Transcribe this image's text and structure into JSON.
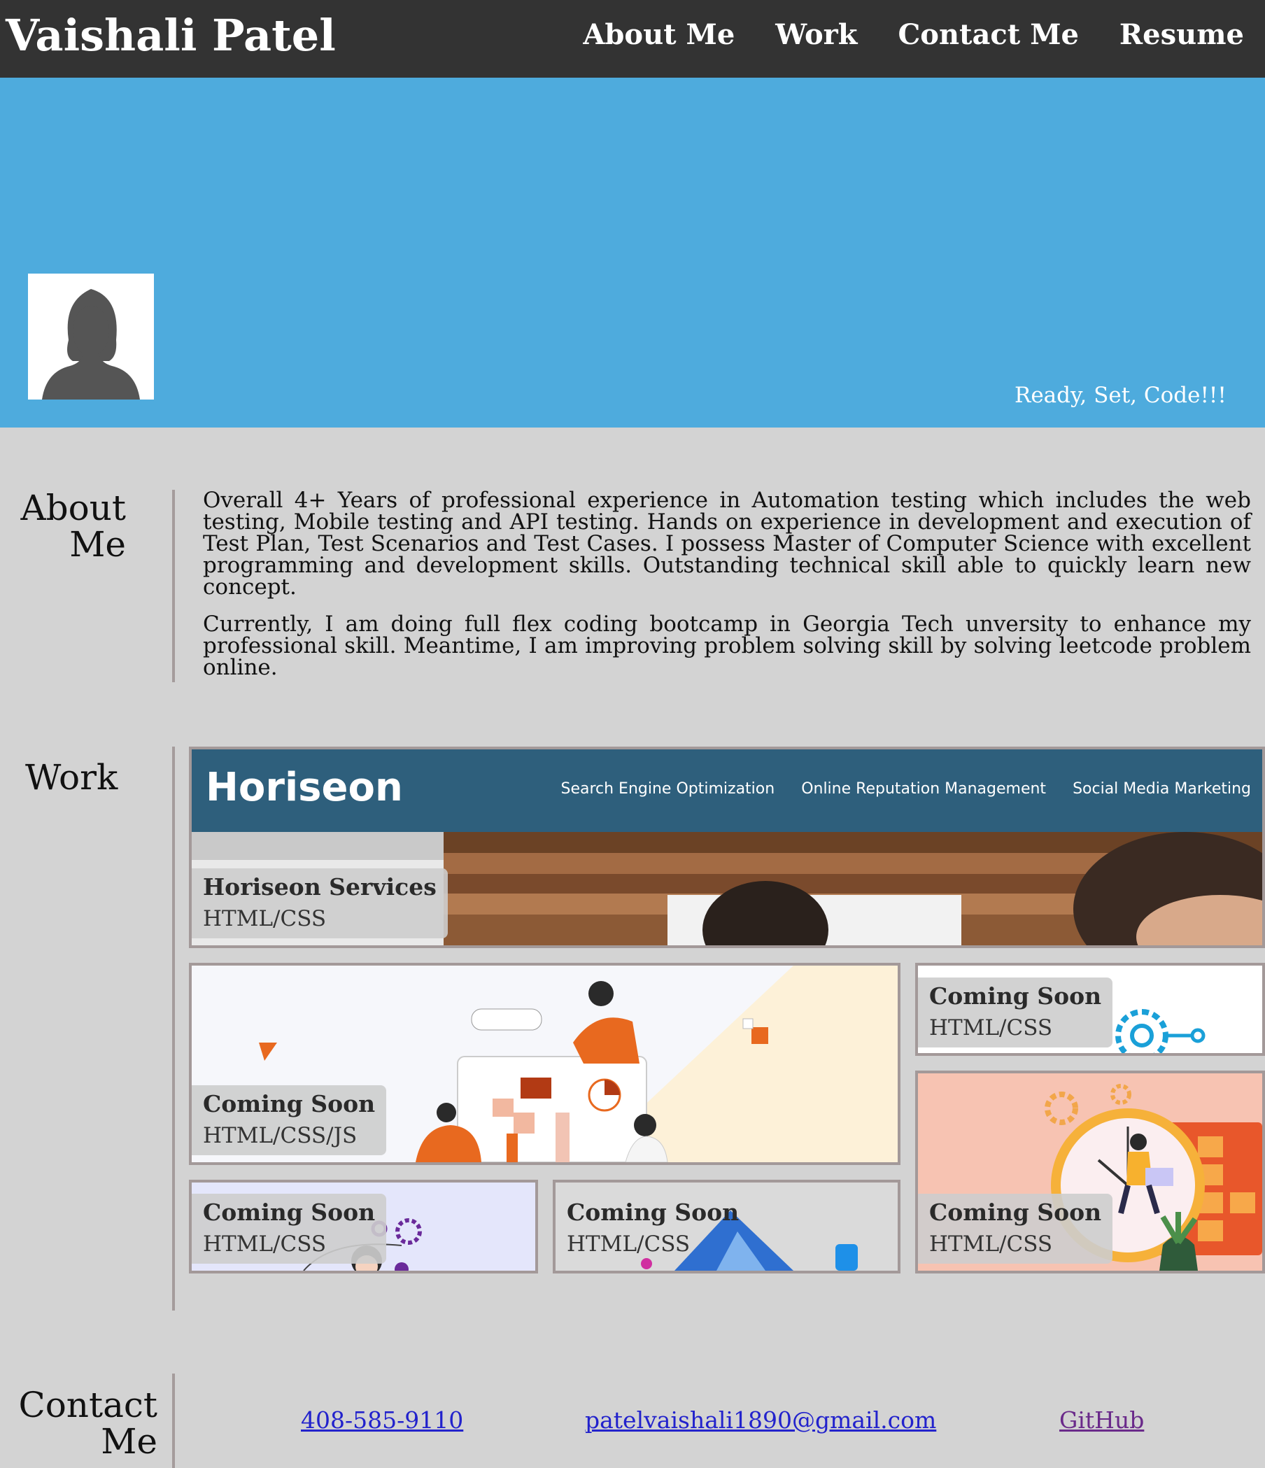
{
  "header": {
    "title": "Vaishali Patel",
    "nav": [
      "About Me",
      "Work",
      "Contact Me",
      "Resume"
    ]
  },
  "hero": {
    "tagline": "Ready, Set, Code!!!",
    "avatar_icon": "user-silhouette-icon"
  },
  "about": {
    "title_line1": "About",
    "title_line2": "Me",
    "paragraphs": [
      "Overall 4+ Years of professional experience in Automation testing which includes the web testing, Mobile testing and API testing. Hands on experience in development and execution of Test Plan, Test Scenarios and Test Cases. I possess Master of Computer Science with excellent programming and development skills. Outstanding technical skill able to quickly learn new concept.",
      "Currently, I am doing full flex coding bootcamp in Georgia Tech unversity to enhance my professional skill. Meantime, I am improving problem solving skill by solving leetcode problem online."
    ]
  },
  "work": {
    "title": "Work",
    "featured": {
      "brand": "Horiseon",
      "nav": [
        "Search Engine Optimization",
        "Online Reputation Management",
        "Social Media Marketing"
      ],
      "title": "Horiseon Services",
      "tech": "HTML/CSS"
    },
    "projects": [
      {
        "title": "Coming Soon",
        "tech": "HTML/CSS/JS"
      },
      {
        "title": "Coming Soon",
        "tech": "HTML/CSS"
      },
      {
        "title": "Coming Soon",
        "tech": "HTML/CSS"
      },
      {
        "title": "Coming Soon",
        "tech": "HTML/CSS"
      },
      {
        "title": "Coming Soon",
        "tech": "HTML/CSS"
      }
    ]
  },
  "contact": {
    "title_line1": "Contact",
    "title_line2": "Me",
    "phone": "408-585-9110",
    "email": "patelvaishali1890@gmail.com",
    "github": "GitHub"
  },
  "colors": {
    "header_bg": "#333333",
    "hero_bg": "#4eabdd",
    "page_bg": "#d3d3d3",
    "horiseon_bar": "#2e5f7c"
  }
}
